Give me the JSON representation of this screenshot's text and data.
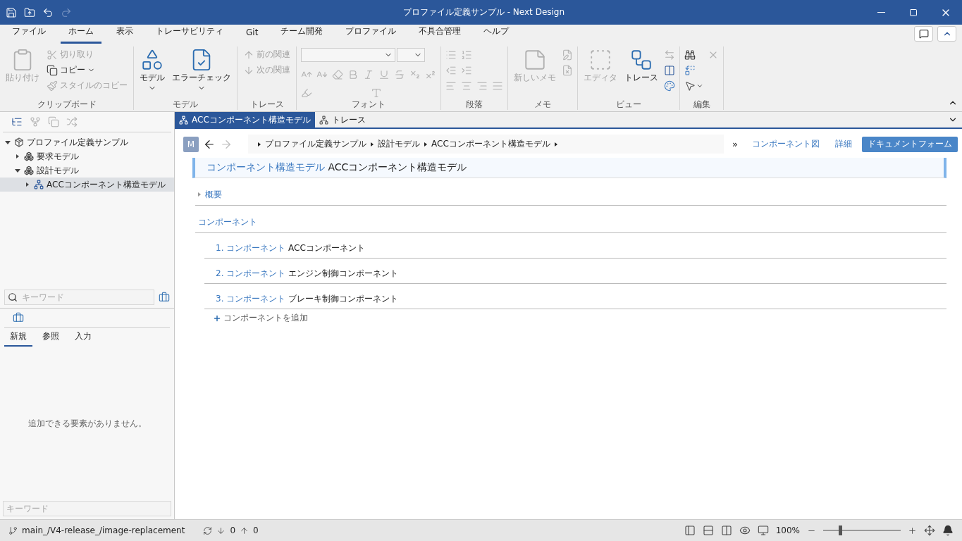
{
  "window": {
    "title": "プロファイル定義サンプル - Next Design"
  },
  "menu_tabs": [
    {
      "label": "ファイル",
      "selected": false
    },
    {
      "label": "ホーム",
      "selected": true
    },
    {
      "label": "表示",
      "selected": false
    },
    {
      "label": "トレーサビリティ",
      "selected": false
    },
    {
      "label": "Git",
      "selected": false
    },
    {
      "label": "チーム開発",
      "selected": false
    },
    {
      "label": "プロファイル",
      "selected": false
    },
    {
      "label": "不具合管理",
      "selected": false
    },
    {
      "label": "ヘルプ",
      "selected": false
    }
  ],
  "ribbon": {
    "groups": [
      {
        "kind": "clipboard",
        "label": "クリップボード",
        "items": [
          {
            "kind": "large",
            "label": "貼り付け",
            "disabled": true,
            "dropdown": false
          },
          {
            "kind": "small",
            "label": "切り取り",
            "disabled": true,
            "dropdown": false
          },
          {
            "kind": "small",
            "label": "コピー",
            "disabled": false,
            "dropdown": true
          },
          {
            "kind": "small",
            "label": "スタイルのコピー",
            "disabled": true,
            "dropdown": false
          }
        ]
      },
      {
        "kind": "model",
        "label": "モデル",
        "items": [
          {
            "kind": "large",
            "label": "モデル",
            "disabled": false,
            "dropdown": true
          },
          {
            "kind": "large",
            "label": "エラーチェック",
            "disabled": false,
            "dropdown": true
          }
        ]
      },
      {
        "kind": "trace",
        "label": "トレース",
        "items": [
          {
            "kind": "small",
            "label": "前の関連",
            "disabled": true,
            "dropdown": false
          },
          {
            "kind": "small",
            "label": "次の関連",
            "disabled": true,
            "dropdown": false
          }
        ]
      },
      {
        "kind": "font",
        "label": "フォント"
      },
      {
        "kind": "paragraph",
        "label": "段落"
      },
      {
        "kind": "memo",
        "label": "メモ",
        "items": [
          {
            "kind": "large",
            "label": "新しいメモ",
            "disabled": true,
            "dropdown": false
          }
        ]
      },
      {
        "kind": "view",
        "label": "ビュー",
        "items": [
          {
            "kind": "large",
            "label": "エディタ",
            "disabled": true,
            "dropdown": false
          },
          {
            "kind": "large",
            "label": "トレース",
            "disabled": false,
            "dropdown": false
          }
        ]
      },
      {
        "kind": "edit",
        "label": "編集"
      }
    ]
  },
  "model_tree": {
    "nodes": [
      {
        "label": "プロファイル定義サンプル",
        "kind": "project",
        "expanded": true,
        "selected": false,
        "children": [
          {
            "label": "要求モデル",
            "kind": "package",
            "expanded": false,
            "selected": false
          },
          {
            "label": "設計モデル",
            "kind": "package",
            "expanded": true,
            "selected": false,
            "children": [
              {
                "label": "ACCコンポーネント構造モデル",
                "kind": "model",
                "expanded": false,
                "selected": true
              }
            ]
          }
        ]
      }
    ]
  },
  "model_search": {
    "placeholder": "キーワード"
  },
  "toolbox": {
    "tabs": [
      {
        "label": "新規",
        "selected": true
      },
      {
        "label": "参照",
        "selected": false
      },
      {
        "label": "入力",
        "selected": false
      }
    ],
    "empty_message": "追加できる要素がありません。",
    "search": {
      "placeholder": "キーワード"
    }
  },
  "editor_tabs": [
    {
      "label": "ACCコンポーネント構造モデル",
      "selected": true
    },
    {
      "label": "トレース",
      "selected": false
    }
  ],
  "navigation": {
    "avatar": "M",
    "breadcrumb": [
      "プロファイル定義サンプル",
      "設計モデル",
      "ACCコンポーネント構造モデル"
    ],
    "overflow": "»",
    "links": [
      "コンポーネント図",
      "詳細"
    ],
    "button": "ドキュメントフォーム"
  },
  "document": {
    "type": "コンポーネント構造モデル",
    "name": "ACCコンポーネント構造モデル",
    "sections": [
      {
        "title": "概要",
        "expanded": false
      },
      {
        "title": "コンポーネント",
        "expanded": true
      }
    ],
    "components": [
      {
        "number": "1.",
        "type": "コンポーネント",
        "name": "ACCコンポーネント"
      },
      {
        "number": "2.",
        "type": "コンポーネント",
        "name": "エンジン制御コンポーネント"
      },
      {
        "number": "3.",
        "type": "コンポーネント",
        "name": "ブレーキ制御コンポーネント"
      }
    ],
    "add_link": "コンポーネントを追加"
  },
  "status_bar": {
    "branch": "main_/V4-release_/image-replacement",
    "incoming": "0",
    "outgoing": "0",
    "zoom": "100%",
    "zoom_slider": {
      "level": 0.2
    }
  }
}
